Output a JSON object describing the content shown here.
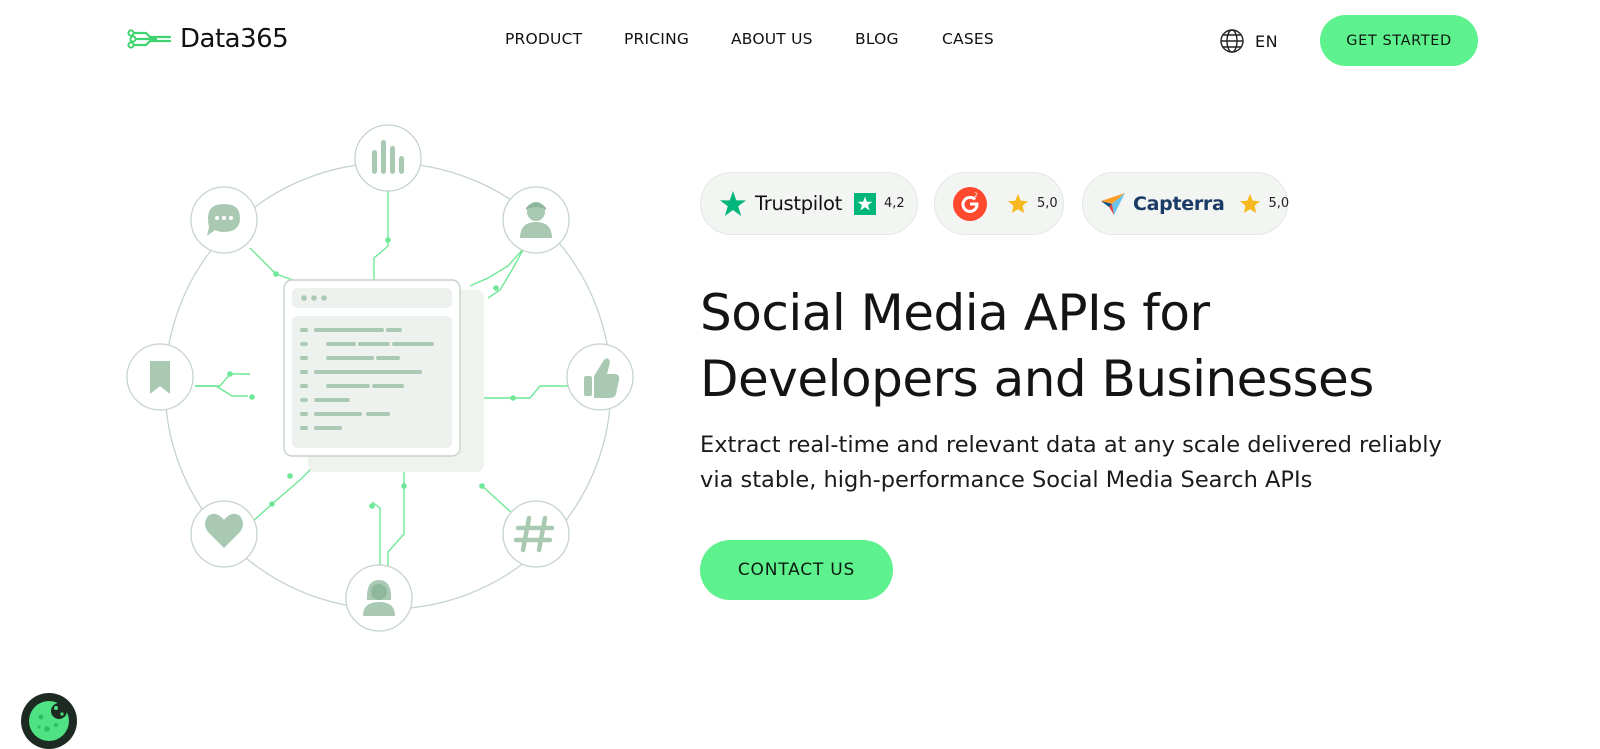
{
  "brand": {
    "name": "Data365",
    "accent_color": "#5ef28f"
  },
  "nav": {
    "items": [
      {
        "label": "PRODUCT"
      },
      {
        "label": "PRICING"
      },
      {
        "label": "ABOUT US"
      },
      {
        "label": "BLOG"
      },
      {
        "label": "CASES"
      }
    ],
    "language": "EN",
    "cta_label": "GET STARTED"
  },
  "ratings": [
    {
      "platform": "Trustpilot",
      "score": "4,2",
      "icon": "trustpilot-star-icon"
    },
    {
      "platform": "G2",
      "score": "5,0",
      "icon": "g2-logo-icon"
    },
    {
      "platform": "Capterra",
      "score": "5,0",
      "icon": "capterra-logo-icon"
    }
  ],
  "hero": {
    "title_line1": "Social Media APIs for",
    "title_line2": "Developers and Businesses",
    "subtitle_line1": "Extract real-time and relevant data at any scale delivered reliably",
    "subtitle_line2": "via stable, high-performance Social Media Search APIs",
    "cta_label": "CONTACT US"
  },
  "illustration_icons": [
    "bar-chart-icon",
    "user-icon",
    "thumbs-up-icon",
    "hashtag-icon",
    "female-user-icon",
    "heart-icon",
    "bookmark-icon",
    "chat-icon"
  ],
  "colors": {
    "icon_fill": "#a9c9b3",
    "line_green": "#6ee896",
    "circle_stroke": "#c6d4ca"
  }
}
